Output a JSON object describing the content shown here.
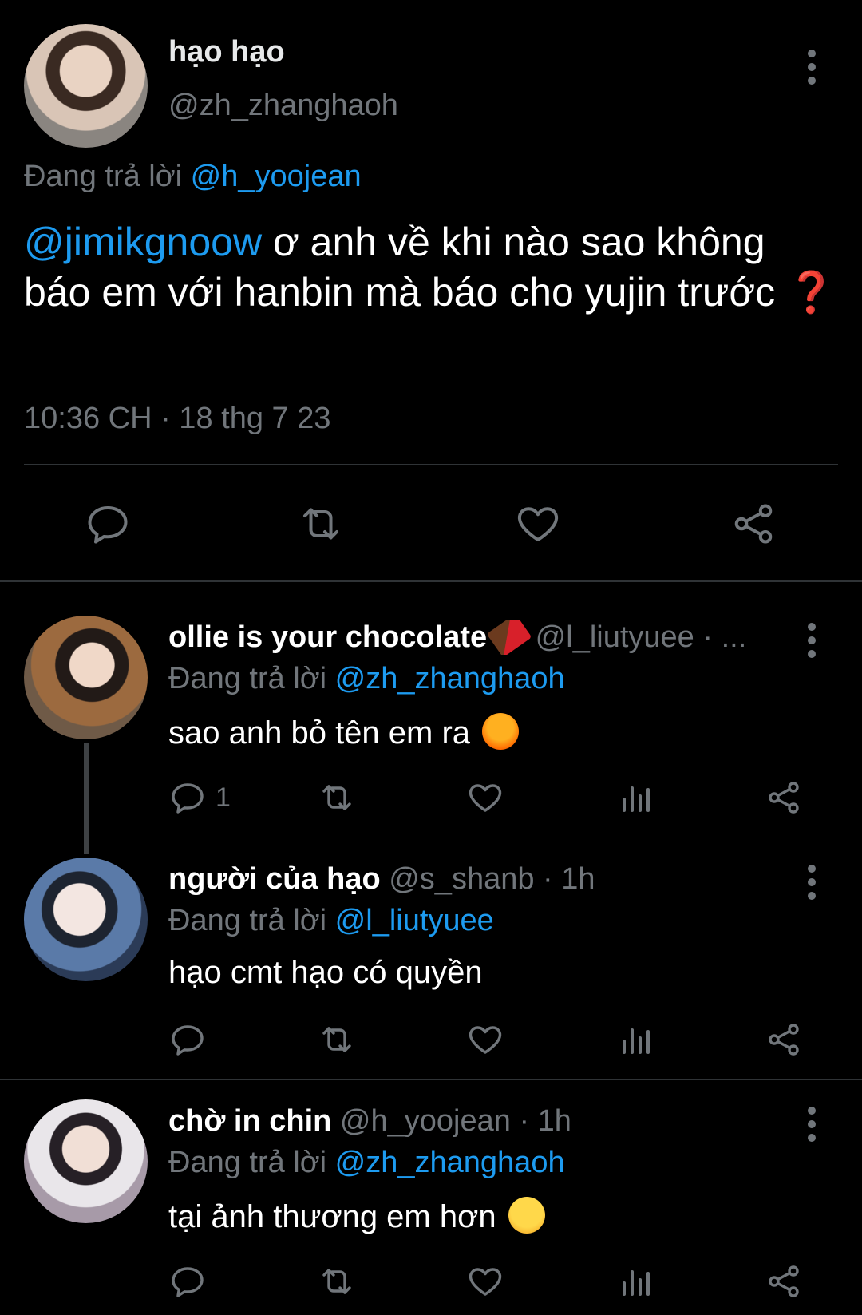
{
  "main_tweet": {
    "author_name": "hạo hạo",
    "author_handle": "@zh_zhanghaoh",
    "replying_prefix": "Đang trả lời ",
    "replying_to": "@h_yoojean",
    "mention": "@jimikgnoow",
    "text": " ơ anh về khi nào sao không báo em với hanbin mà báo cho yujin trước ",
    "text_emoji": "❓",
    "timestamp": "10:36 CH · 18 thg 7 23",
    "actions": [
      "reply-icon",
      "retweet-icon",
      "like-icon",
      "share-icon"
    ]
  },
  "replies": [
    {
      "name": "ollie is your chocolate",
      "name_emoji": "chocolate-bar",
      "handle": " @l_liutyuee · ...",
      "replying_prefix": "Đang trả lời ",
      "replying_to": "@zh_zhanghaoh",
      "text": "sao anh bỏ tên em ra ",
      "text_emoji": "angry-face",
      "reply_count": "1"
    },
    {
      "name": "người của hạo",
      "handle": " @s_shanb · 1h",
      "replying_prefix": "Đang trả lời ",
      "replying_to": "@l_liutyuee",
      "text": "hạo cmt hạo có quyền",
      "reply_count": ""
    },
    {
      "name": "chờ in chin",
      "handle": " @h_yoojean · 1h",
      "replying_prefix": "Đang trả lời ",
      "replying_to": "@zh_zhanghaoh",
      "text": "tại ảnh thương em hơn ",
      "text_emoji": "smirking-face",
      "reply_count": ""
    }
  ],
  "colors": {
    "background": "#000000",
    "text": "#e7e9ea",
    "muted": "#71767b",
    "link": "#1d9bf0",
    "divider": "#2f3336"
  }
}
